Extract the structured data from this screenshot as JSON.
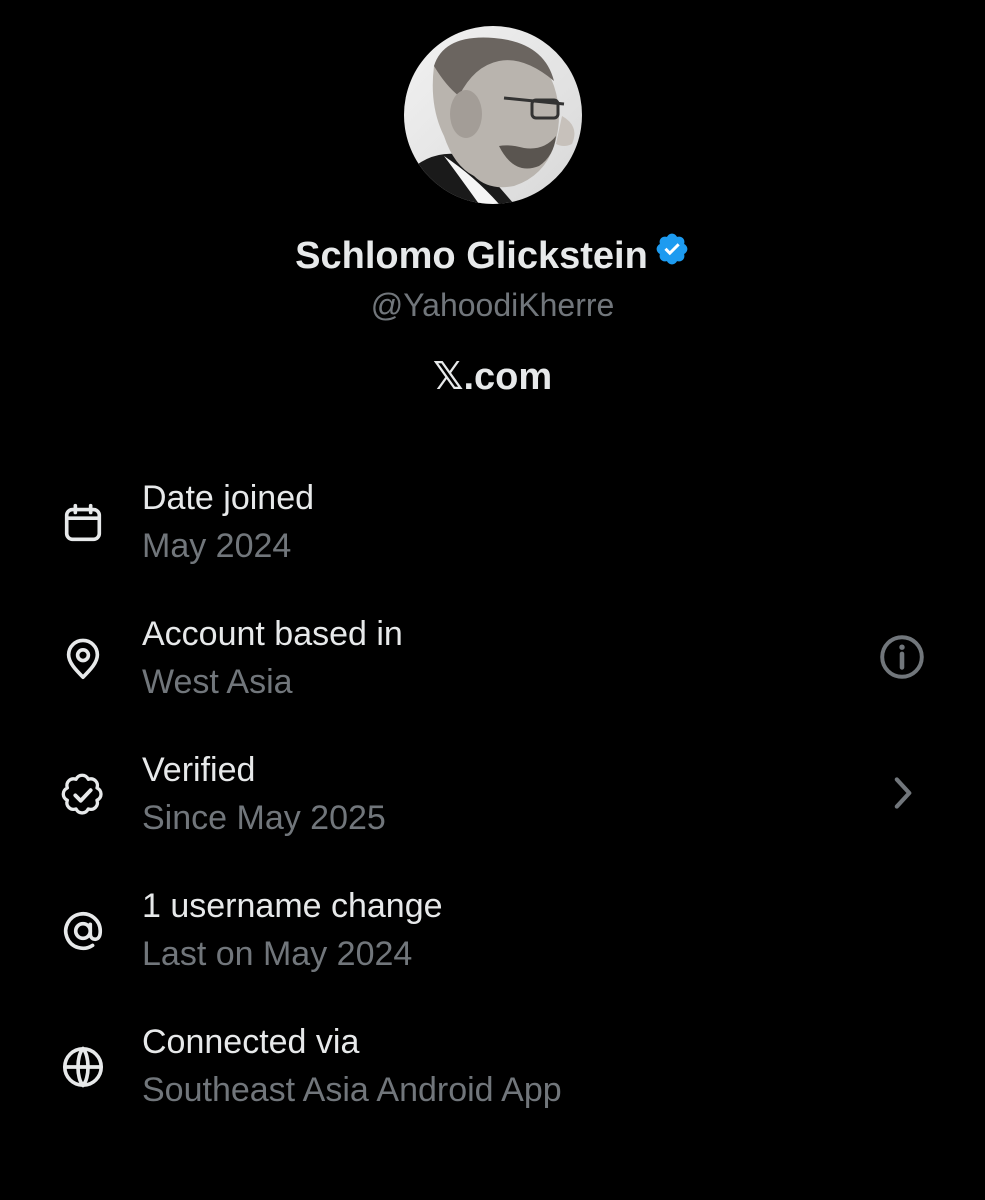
{
  "profile": {
    "display_name": "Schlomo Glickstein",
    "handle": "@YahoodiKherre",
    "site": ".com",
    "site_logo_glyph": "𝕏",
    "verified_badge_color": "#1d9bf0",
    "avatar_icon": "profile-photo"
  },
  "info_rows": [
    {
      "icon": "calendar-icon",
      "title": "Date joined",
      "subtitle": "May 2024"
    },
    {
      "icon": "location-pin-icon",
      "title": "Account based in",
      "subtitle": "West Asia",
      "action_icon": "info-icon"
    },
    {
      "icon": "verified-check-icon",
      "title": "Verified",
      "subtitle": "Since May 2025",
      "action_icon": "chevron-right-icon"
    },
    {
      "icon": "at-sign-icon",
      "title": "1 username change",
      "subtitle": "Last on May 2024"
    },
    {
      "icon": "globe-icon",
      "title": "Connected via",
      "subtitle": "Southeast Asia Android App"
    }
  ],
  "colors": {
    "background": "#000000",
    "primary_text": "#e7e9ea",
    "secondary_text": "#71767b",
    "accent": "#1d9bf0"
  }
}
